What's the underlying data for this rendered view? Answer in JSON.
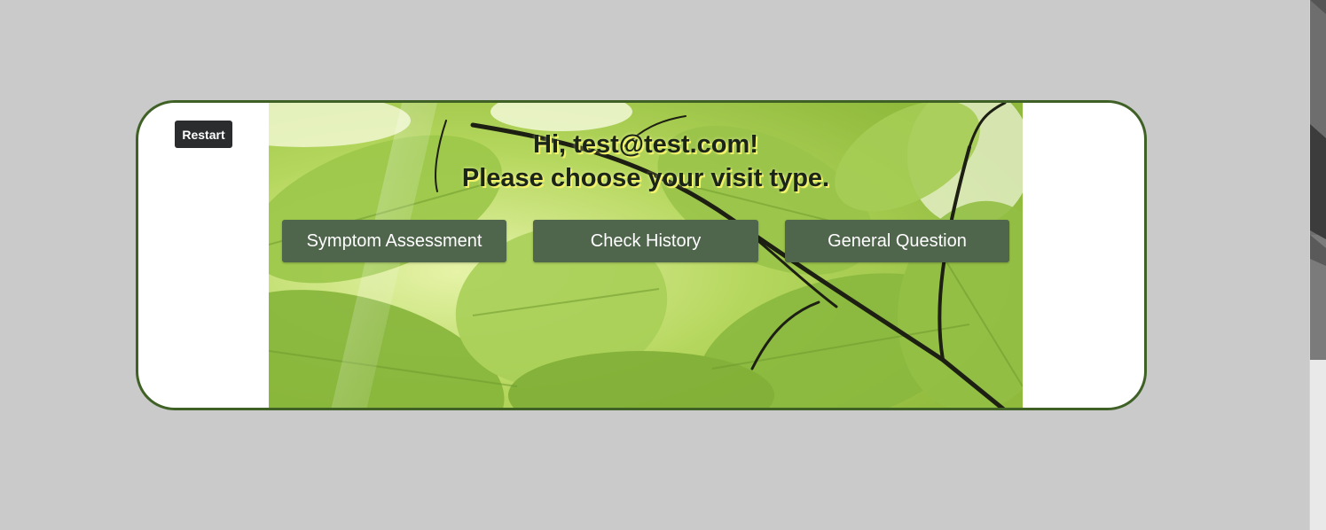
{
  "card": {
    "restart_label": "Restart"
  },
  "hero": {
    "greeting_line1": "Hi, test@test.com!",
    "greeting_line2": "Please choose your visit type.",
    "image": "green-leaves-background"
  },
  "visit_types": [
    {
      "label": "Symptom Assessment"
    },
    {
      "label": "Check History"
    },
    {
      "label": "General Question"
    }
  ],
  "colors": {
    "page_background": "#cacaca",
    "card_border": "#3f6126",
    "button_background": "#4f654c",
    "restart_background": "#2a2c2e",
    "greeting_text": "#1a2418",
    "greeting_shadow": "#f2f36a"
  }
}
